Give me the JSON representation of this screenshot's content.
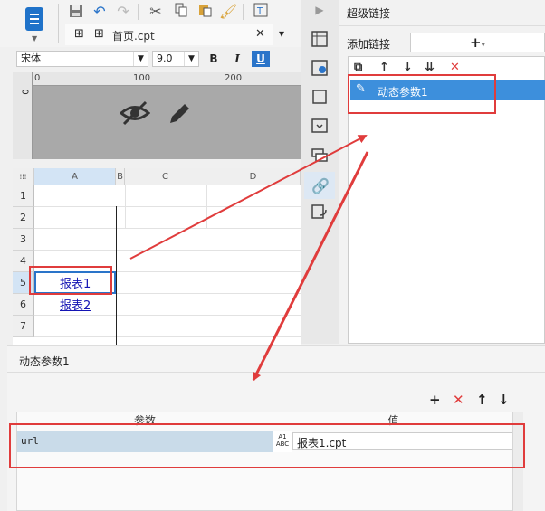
{
  "editor": {
    "tab_label": "首页.cpt",
    "font_name": "宋体",
    "font_size": "9.0",
    "bold_label": "B",
    "italic_label": "I",
    "underline_label": "U",
    "ruler_marks": [
      "0",
      "100",
      "200"
    ],
    "ruler_v_mark": "0"
  },
  "sheet": {
    "columns": [
      "A",
      "B",
      "C",
      "D"
    ],
    "rows": [
      "1",
      "2",
      "3",
      "4",
      "5",
      "6",
      "7"
    ],
    "cells": {
      "A5": "报表1",
      "A6": "报表2"
    }
  },
  "right_panel": {
    "title": "超级链接",
    "add_label": "添加链接",
    "add_button": "+",
    "items": [
      {
        "label": "动态参数1"
      }
    ]
  },
  "dialog": {
    "title": "动态参数1",
    "columns": [
      "参数",
      "值"
    ],
    "rows": [
      {
        "param": "url",
        "type_icon": "A1 ABC",
        "value": "报表1.cpt"
      }
    ]
  },
  "colors": {
    "accent": "#3d8fdc",
    "annotation": "#e03c3c",
    "link": "#1414b4"
  }
}
